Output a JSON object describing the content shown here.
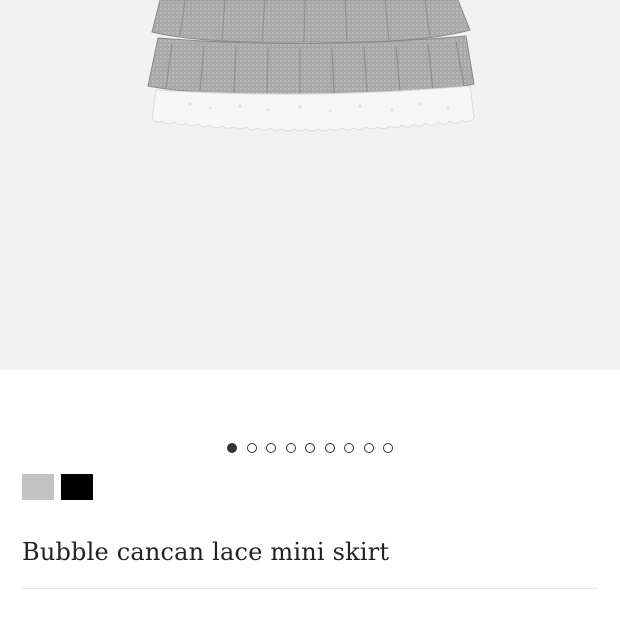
{
  "product": {
    "title": "Bubble cancan lace mini skirt",
    "image_alt": "Bubble cancan lace mini skirt"
  },
  "gallery": {
    "total_images": 9,
    "active_index": 0
  },
  "colors": {
    "background_hero": "#f2f2f2",
    "dot_border": "#333333",
    "swatch_gray": "#c3c3c3",
    "swatch_black": "#000000"
  },
  "swatches": [
    {
      "name": "swatch-gray",
      "color": "#c3c3c3"
    },
    {
      "name": "swatch-black",
      "color": "#000000"
    }
  ]
}
